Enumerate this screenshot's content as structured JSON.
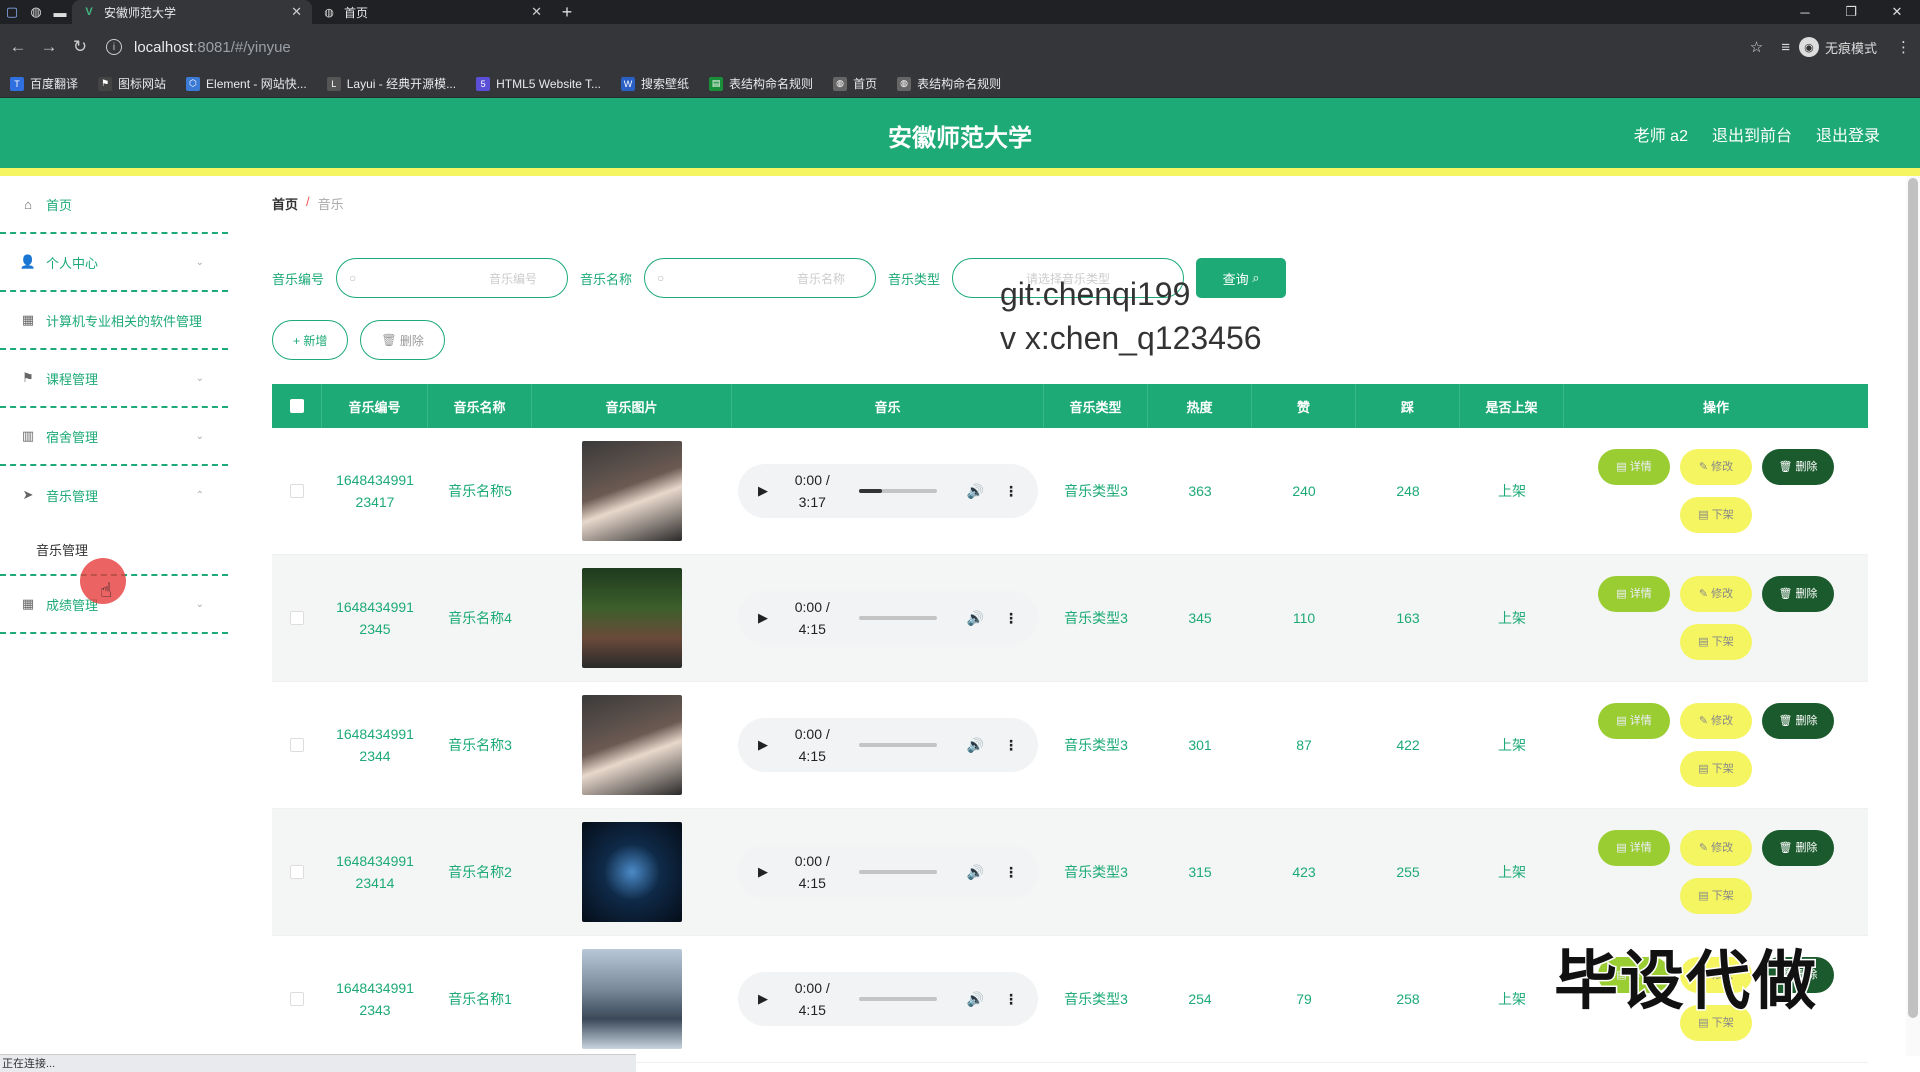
{
  "browser": {
    "tabs": [
      {
        "title": "安徽师范大学",
        "active": true
      },
      {
        "title": "首页",
        "active": false
      }
    ],
    "new_tab": "+",
    "url_host": "localhost",
    "url_path": ":8081/#/yinyue",
    "profile_label": "无痕模式",
    "bookmarks": [
      "百度翻译",
      "图标网站",
      "Element - 网站快...",
      "Layui - 经典开源模...",
      "HTML5 Website T...",
      "搜索壁纸",
      "表结构命名规则",
      "首页",
      "表结构命名规则"
    ],
    "status_text": "正在连接..."
  },
  "header": {
    "title": "安徽师范大学",
    "user": "老师 a2",
    "back_front": "退出到前台",
    "logout": "退出登录"
  },
  "sidebar": {
    "items": [
      {
        "label": "首页",
        "icon": "home-icon",
        "chevron": false
      },
      {
        "label": "个人中心",
        "icon": "user-icon",
        "chevron": true
      },
      {
        "label": "计算机专业相关的软件管理",
        "icon": "briefcase-icon",
        "chevron": false
      },
      {
        "label": "课程管理",
        "icon": "flag-icon",
        "chevron": true
      },
      {
        "label": "宿舍管理",
        "icon": "bar-chart-icon",
        "chevron": true
      },
      {
        "label": "音乐管理",
        "icon": "send-icon",
        "chevron": true
      }
    ],
    "sub_item": "音乐管理",
    "last_item": {
      "label": "成绩管理",
      "icon": "grid-icon",
      "chevron": true
    }
  },
  "breadcrumb": {
    "home": "首页",
    "sep": "/",
    "current": "音乐"
  },
  "search": {
    "label_number": "音乐编号",
    "placeholder_number": "音乐编号",
    "label_name": "音乐名称",
    "placeholder_name": "音乐名称",
    "label_type": "音乐类型",
    "placeholder_type": "请选择音乐类型",
    "query_button": "查询"
  },
  "watermark": {
    "line1": "git:chenqi199",
    "line2": "v x:chen_q123456",
    "bottom": "毕设代做"
  },
  "actions": {
    "add": "+ 新增",
    "delete": "删除"
  },
  "table": {
    "headers": [
      "音乐编号",
      "音乐名称",
      "音乐图片",
      "音乐",
      "音乐类型",
      "热度",
      "赞",
      "踩",
      "是否上架",
      "操作"
    ],
    "rows": [
      {
        "id1": "1648434991",
        "id2": "23417",
        "name": "音乐名称5",
        "time": "0:00 / 3:17",
        "progress": 0.3,
        "type": "音乐类型3",
        "heat": "363",
        "like": "240",
        "dislike": "248",
        "shelf": "上架"
      },
      {
        "id1": "1648434991",
        "id2": "2345",
        "name": "音乐名称4",
        "time": "0:00 / 4:15",
        "progress": 0,
        "type": "音乐类型3",
        "heat": "345",
        "like": "110",
        "dislike": "163",
        "shelf": "上架"
      },
      {
        "id1": "1648434991",
        "id2": "2344",
        "name": "音乐名称3",
        "time": "0:00 / 4:15",
        "progress": 0,
        "type": "音乐类型3",
        "heat": "301",
        "like": "87",
        "dislike": "422",
        "shelf": "上架"
      },
      {
        "id1": "1648434991",
        "id2": "23414",
        "name": "音乐名称2",
        "time": "0:00 / 4:15",
        "progress": 0,
        "type": "音乐类型3",
        "heat": "315",
        "like": "423",
        "dislike": "255",
        "shelf": "上架"
      },
      {
        "id1": "1648434991",
        "id2": "2343",
        "name": "音乐名称1",
        "time": "0:00 / 4:15",
        "progress": 0,
        "type": "音乐类型3",
        "heat": "254",
        "like": "79",
        "dislike": "258",
        "shelf": "上架"
      }
    ],
    "op_detail": "详情",
    "op_edit": "修改",
    "op_delete": "删除",
    "op_down": "下架"
  },
  "colors": {
    "primary": "#1daa77",
    "accent_yellow": "#f5f562",
    "dark_green": "#1a5a2c",
    "lime": "#9acd32"
  }
}
